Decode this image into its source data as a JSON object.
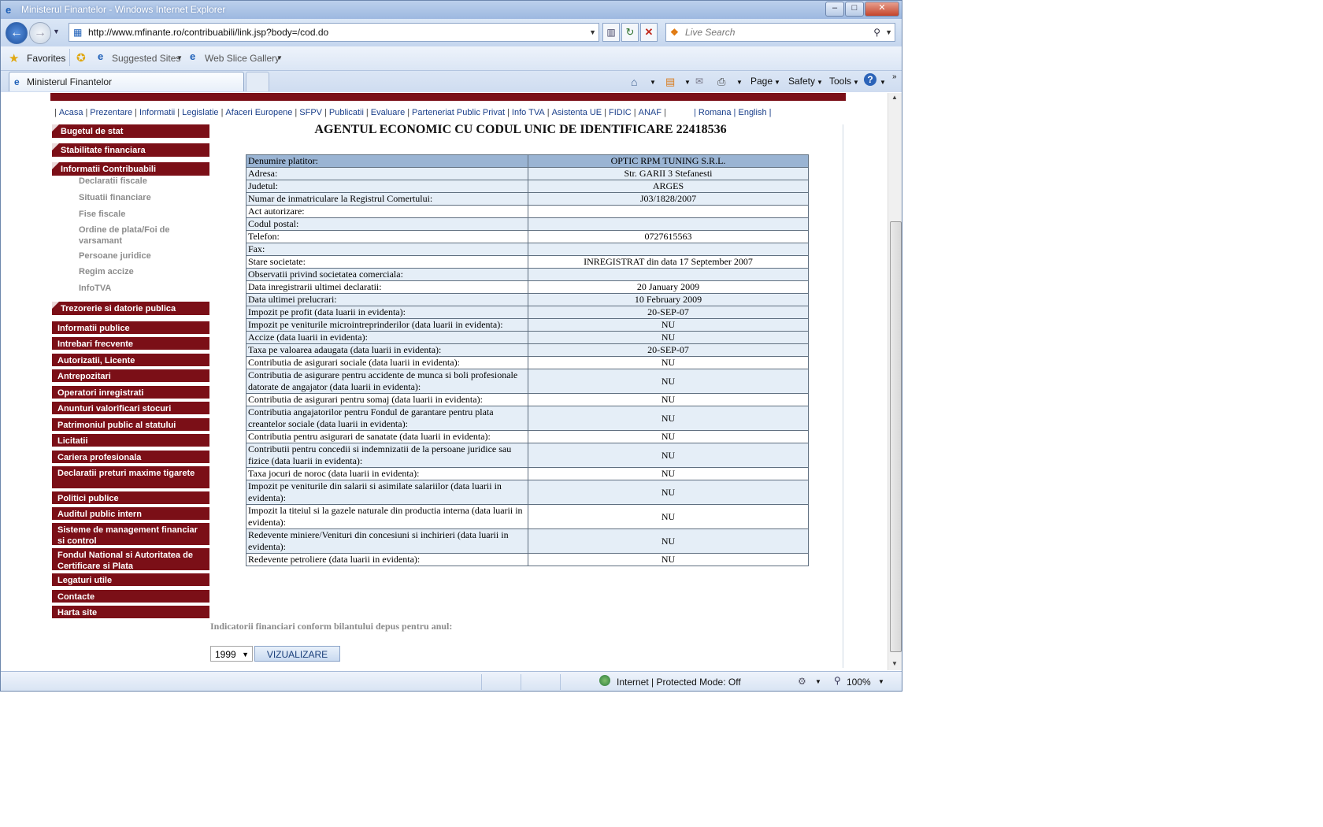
{
  "window": {
    "title": "Ministerul Finantelor - Windows Internet Explorer",
    "min_glyph": "‒",
    "max_glyph": "□",
    "close_glyph": "✕"
  },
  "nav": {
    "url": "http://www.mfinante.ro/contribuabili/link.jsp?body=/cod.do",
    "search_placeholder": "Live Search"
  },
  "favorites_bar": {
    "favorites": "Favorites",
    "suggested": "Suggested Sites",
    "webslice": "Web Slice Gallery"
  },
  "tab": {
    "title": "Ministerul Finantelor"
  },
  "command_bar": {
    "page": "Page",
    "safety": "Safety",
    "tools": "Tools"
  },
  "status": {
    "zone": "Internet | Protected Mode: Off",
    "zoom": "100%"
  },
  "topnav": [
    "Acasa",
    "Prezentare",
    "Informatii",
    "Legislatie",
    "Afaceri Europene",
    "SFPV",
    "Publicatii",
    "Evaluare",
    "Parteneriat Public Privat",
    "Info TVA",
    "Asistenta UE",
    "FIDIC",
    "ANAF"
  ],
  "lang": [
    "Romana",
    "English"
  ],
  "sidebar": {
    "main1": [
      "Bugetul de stat",
      "Stabilitate financiara",
      "Informatii Contribuabili"
    ],
    "sub": [
      "Declaratii fiscale",
      "Situatii financiare",
      "Fise fiscale",
      "Ordine de plata/Foi de varsamant",
      "Persoane juridice",
      "Regim accize",
      "InfoTVA"
    ],
    "main2": [
      "Trezorerie si datorie publica",
      "Informatii publice",
      "Intrebari frecvente",
      "Autorizatii, Licente",
      "Antrepozitari",
      "Operatori inregistrati",
      "Anunturi valorificari stocuri",
      "Patrimoniul public al statului",
      "Licitatii",
      "Cariera profesionala",
      "Declaratii preturi maxime tigarete",
      "Politici publice",
      "Auditul public intern",
      "Sisteme de management financiar si control",
      "Fondul National si Autoritatea de Certificare si Plata",
      "Legaturi utile",
      "Contacte",
      "Harta site"
    ]
  },
  "heading": "AGENTUL ECONOMIC CU CODUL UNIC DE IDENTIFICARE 22418536",
  "rows": [
    {
      "label": "Denumire platitor:",
      "value": "OPTIC RPM TUNING S.R.L."
    },
    {
      "label": "Adresa:",
      "value": "Str. GARII 3 Stefanesti"
    },
    {
      "label": "Judetul:",
      "value": "ARGES"
    },
    {
      "label": "Numar de inmatriculare la Registrul Comertului:",
      "value": "J03/1828/2007"
    },
    {
      "label": "Act autorizare:",
      "value": ""
    },
    {
      "label": "Codul postal:",
      "value": ""
    },
    {
      "label": "Telefon:",
      "value": "0727615563"
    },
    {
      "label": "Fax:",
      "value": ""
    },
    {
      "label": "Stare societate:",
      "value": "INREGISTRAT din data 17 September 2007"
    },
    {
      "label": "Observatii privind societatea comerciala:",
      "value": ""
    },
    {
      "label": "Data inregistrarii ultimei declaratii:",
      "value": "20 January 2009"
    },
    {
      "label": "Data ultimei prelucrari:",
      "value": "10 February 2009"
    },
    {
      "label": "Impozit pe profit (data luarii in evidenta):",
      "value": "20-SEP-07"
    },
    {
      "label": "Impozit pe veniturile microintreprinderilor (data luarii in evidenta):",
      "value": "NU"
    },
    {
      "label": "Accize (data luarii in evidenta):",
      "value": "NU"
    },
    {
      "label": "Taxa pe valoarea adaugata (data luarii in evidenta):",
      "value": "20-SEP-07"
    },
    {
      "label": "Contributia de asigurari sociale (data luarii in evidenta):",
      "value": "NU"
    },
    {
      "label": "Contributia de asigurare pentru accidente de munca si boli profesionale datorate de angajator (data luarii in evidenta):",
      "value": "NU"
    },
    {
      "label": "Contributia de asigurari pentru somaj (data luarii in evidenta):",
      "value": "NU"
    },
    {
      "label": "Contributia angajatorilor pentru Fondul de garantare pentru plata creantelor sociale (data luarii in evidenta):",
      "value": "NU"
    },
    {
      "label": "Contributia pentru asigurari de sanatate (data luarii in evidenta):",
      "value": "NU"
    },
    {
      "label": "Contributii pentru concedii si indemnizatii de la persoane juridice sau fizice (data luarii in evidenta):",
      "value": "NU"
    },
    {
      "label": "Taxa jocuri de noroc (data luarii in evidenta):",
      "value": "NU"
    },
    {
      "label": "Impozit pe veniturile din salarii si asimilate salariilor (data luarii in evidenta):",
      "value": "NU"
    },
    {
      "label": "Impozit la titeiul si la gazele naturale din productia interna (data luarii in evidenta):",
      "value": "NU"
    },
    {
      "label": "Redevente miniere/Venituri din concesiuni si inchirieri (data luarii in evidenta):",
      "value": "NU"
    },
    {
      "label": "Redevente petroliere (data luarii in evidenta):",
      "value": "NU"
    }
  ],
  "indicators_label": "Indicatorii financiari conform bilantului depus pentru anul:",
  "year_selected": "1999",
  "viz_button": "VIZUALIZARE"
}
